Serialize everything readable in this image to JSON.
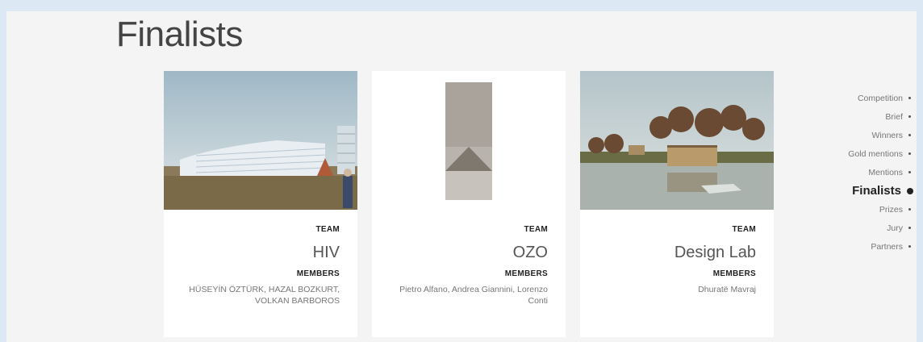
{
  "page": {
    "title": "Finalists"
  },
  "cards": [
    {
      "team_label": "TEAM",
      "team": "HIV",
      "members_label": "MEMBERS",
      "members": "HÜSEYİN ÖZTÜRK, HAZAL BOZKURT, VOLKAN BARBOROS"
    },
    {
      "team_label": "TEAM",
      "team": "OZO",
      "members_label": "MEMBERS",
      "members": "Pietro Alfano, Andrea Giannini, Lorenzo Conti"
    },
    {
      "team_label": "TEAM",
      "team": "Design Lab",
      "members_label": "MEMBERS",
      "members": "Dhuratë Mavraj"
    }
  ],
  "nav": {
    "items": [
      {
        "label": "Competition"
      },
      {
        "label": "Brief"
      },
      {
        "label": "Winners"
      },
      {
        "label": "Gold mentions"
      },
      {
        "label": "Mentions"
      },
      {
        "label": "Finalists",
        "active": true
      },
      {
        "label": "Prizes"
      },
      {
        "label": "Jury"
      },
      {
        "label": "Partners"
      }
    ]
  }
}
